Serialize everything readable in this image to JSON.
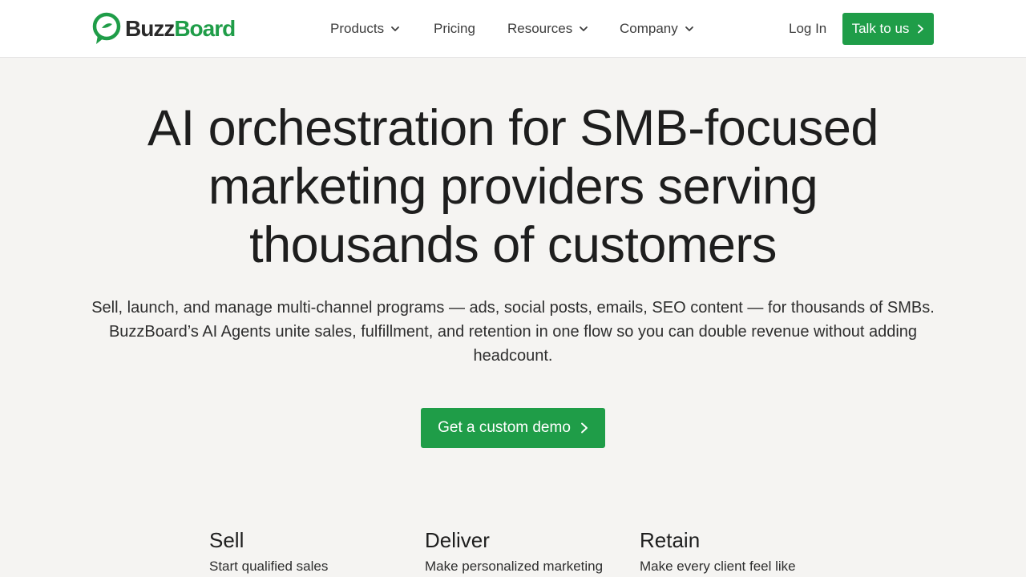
{
  "brand": {
    "name_part1": "Buzz",
    "name_part2": "Board",
    "color": "#1f9d48",
    "logo_icon": "speech-bubble-logo-icon"
  },
  "nav": {
    "items": [
      {
        "label": "Products",
        "has_dropdown": true
      },
      {
        "label": "Pricing",
        "has_dropdown": false
      },
      {
        "label": "Resources",
        "has_dropdown": true
      },
      {
        "label": "Company",
        "has_dropdown": true
      }
    ],
    "login_label": "Log In",
    "cta_label": "Talk to us"
  },
  "hero": {
    "title_line1": "AI orchestration for SMB-focused",
    "title_line2": "marketing providers serving",
    "title_line3": "thousands of customers",
    "subtitle": "Sell, launch, and manage multi-channel programs — ads, social posts, emails, SEO content — for thousands of SMBs. BuzzBoard’s AI Agents unite sales, fulfillment, and retention in one flow so you can double revenue without adding headcount.",
    "cta_label": "Get a custom demo"
  },
  "features": [
    {
      "title": "Sell",
      "text": "Start qualified sales"
    },
    {
      "title": "Deliver",
      "text": "Make personalized marketing"
    },
    {
      "title": "Retain",
      "text": "Make every client feel like"
    }
  ]
}
